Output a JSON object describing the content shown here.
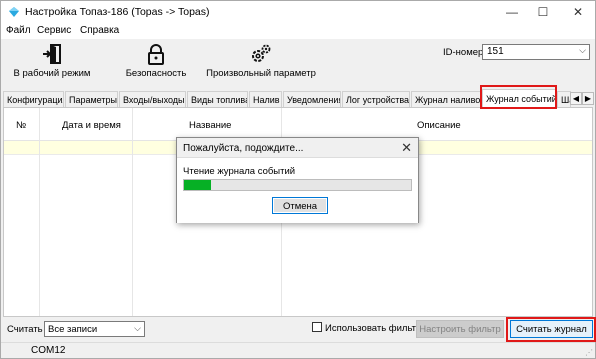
{
  "window": {
    "title": "Настройка Топаз-186 (Topas -> Topas)",
    "minimize": "—",
    "maximize": "☐",
    "close": "✕"
  },
  "menu": [
    "Файл",
    "Сервис",
    "Справка"
  ],
  "toolbar": {
    "work_mode": "В рабочий режим",
    "security": "Безопасность",
    "custom_param": "Произвольный параметр",
    "id_label": "ID-номер",
    "id_value": "151"
  },
  "tabs": [
    "Конфигурация",
    "Параметры",
    "Входы/выходы",
    "Виды топлива",
    "Налив",
    "Уведомления",
    "Лог устройства",
    "Журнал наливов",
    "Журнал событий",
    "Ша"
  ],
  "active_tab_index": 8,
  "grid": {
    "columns": [
      "№",
      "Дата и время",
      "Название",
      "Описание"
    ]
  },
  "dialog": {
    "title": "Пожалуйста, подождите...",
    "status": "Чтение журнала событий",
    "progress": 0.12,
    "cancel": "Отмена"
  },
  "bottom": {
    "read_label": "Считать",
    "records_option": "Все записи",
    "use_filter": "Использовать фильтр",
    "configure_filter": "Настроить фильтр",
    "read_journal": "Считать журнал"
  },
  "status": {
    "port": "COM12"
  },
  "colors": {
    "highlight": "#e01818",
    "progress": "#06b025",
    "accent": "#0078d7",
    "selected_row": "#ffffe0"
  }
}
